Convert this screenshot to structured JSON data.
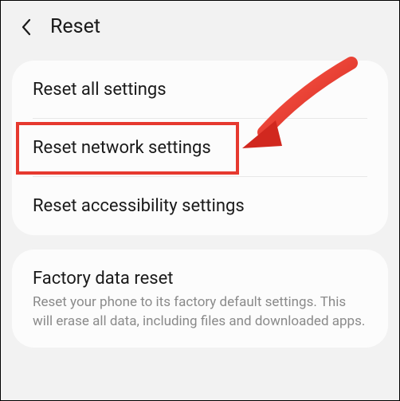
{
  "header": {
    "title": "Reset"
  },
  "group1": {
    "items": [
      {
        "title": "Reset all settings"
      },
      {
        "title": "Reset network settings"
      },
      {
        "title": "Reset accessibility settings"
      }
    ]
  },
  "group2": {
    "items": [
      {
        "title": "Factory data reset",
        "description": "Reset your phone to its factory default settings. This will erase all data, including files and downloaded apps."
      }
    ]
  },
  "annotation": {
    "highlight_color": "#e6392f",
    "arrow_color": "#e6392f"
  }
}
